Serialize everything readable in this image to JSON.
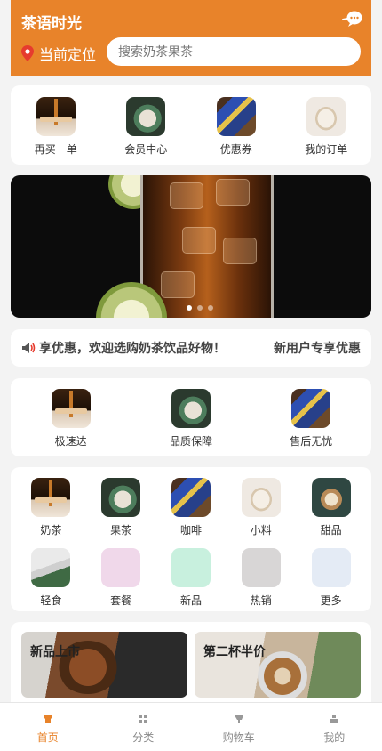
{
  "header": {
    "title": "茶语时光",
    "location_label": "当前定位",
    "search_placeholder": "搜索奶茶果茶",
    "accent_color": "#e8832a",
    "icons": {
      "chat": "chat-bubble-icon",
      "location": "location-pin-icon"
    }
  },
  "quick_actions": [
    {
      "label": "再买一单",
      "image": "caramel-drizzle"
    },
    {
      "label": "会员中心",
      "image": "cake-on-plate"
    },
    {
      "label": "优惠券",
      "image": "tea-tins"
    },
    {
      "label": "我的订单",
      "image": "teacup"
    }
  ],
  "banner": {
    "slides": 3,
    "active_slide": 1,
    "subject": "iced tea glass with lime"
  },
  "notice": {
    "icon": "speaker-icon",
    "text": "享优惠，欢迎选购奶茶饮品好物！",
    "right_text": "新用户专享优惠"
  },
  "services": [
    {
      "label": "极速达",
      "image": "caramel-drizzle"
    },
    {
      "label": "品质保障",
      "image": "cake-on-plate"
    },
    {
      "label": "售后无忧",
      "image": "tea-tins"
    }
  ],
  "categories_row1": [
    {
      "label": "奶茶",
      "image": "caramel-drizzle"
    },
    {
      "label": "果茶",
      "image": "cake-on-plate"
    },
    {
      "label": "咖啡",
      "image": "tea-tins"
    },
    {
      "label": "小料",
      "image": "teacup"
    },
    {
      "label": "甜品",
      "image": "latte"
    }
  ],
  "categories_row2": [
    {
      "label": "轻食",
      "image": "mug"
    },
    {
      "label": "套餐",
      "color": "#f0d8ea"
    },
    {
      "label": "新品",
      "color": "#c8f0de"
    },
    {
      "label": "热销",
      "color": "#d8d6d6"
    },
    {
      "label": "更多",
      "color": "#e4ebf5"
    }
  ],
  "promos": [
    {
      "title": "新品上市"
    },
    {
      "title": "第二杯半价"
    }
  ],
  "tabbar": [
    {
      "label": "首页",
      "icon": "home-icon",
      "active": true
    },
    {
      "label": "分类",
      "icon": "grid-icon",
      "active": false
    },
    {
      "label": "购物车",
      "icon": "cart-icon",
      "active": false
    },
    {
      "label": "我的",
      "icon": "user-icon",
      "active": false
    }
  ]
}
